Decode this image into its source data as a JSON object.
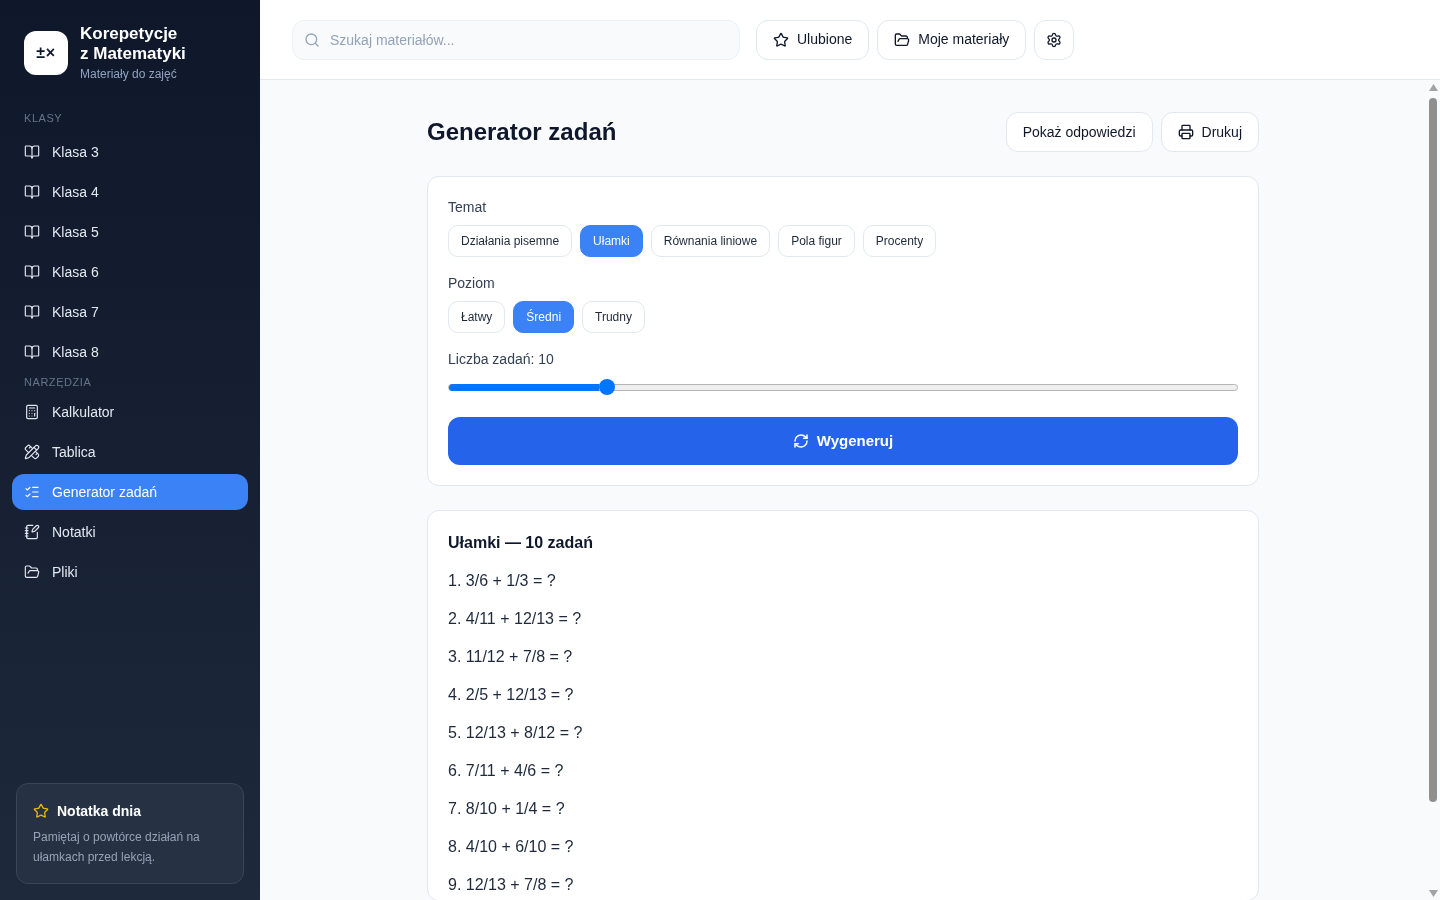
{
  "sidebar": {
    "logo": "±×",
    "title_lines": [
      "Korepetycje",
      "z Matematyki"
    ],
    "subtitle": "Materiały do zajęć",
    "sections": [
      {
        "label": "KLASY",
        "items": [
          {
            "label": "Klasa 3",
            "selected": false
          },
          {
            "label": "Klasa 4",
            "selected": false
          },
          {
            "label": "Klasa 5",
            "selected": false
          },
          {
            "label": "Klasa 6",
            "selected": false
          },
          {
            "label": "Klasa 7",
            "selected": false
          },
          {
            "label": "Klasa 8",
            "selected": false
          }
        ]
      },
      {
        "label": "NARZĘDZIA",
        "items": [
          {
            "label": "Kalkulator",
            "selected": false
          },
          {
            "label": "Tablica",
            "selected": false
          },
          {
            "label": "Generator zadań",
            "selected": true
          },
          {
            "label": "Notatki",
            "selected": false
          },
          {
            "label": "Pliki",
            "selected": false
          }
        ]
      }
    ],
    "note_card": {
      "title": "Notatka dnia",
      "text": "Pamiętaj o powtórce działań na ułamkach przed lekcją."
    }
  },
  "top_bar": {
    "search": {
      "placeholder": "Szukaj materiałów..."
    },
    "buttons": [
      "Ulubione",
      "Moje materiały"
    ]
  },
  "page": {
    "title": "Generator zadań",
    "actions": [
      "Pokaż odpowiedzi",
      "Drukuj"
    ]
  },
  "generator": {
    "topic": {
      "label": "Temat",
      "options": [
        {
          "label": "Działania pisemne",
          "selected": false
        },
        {
          "label": "Ułamki",
          "selected": true
        },
        {
          "label": "Równania liniowe",
          "selected": false
        },
        {
          "label": "Pola figur",
          "selected": false
        },
        {
          "label": "Procenty",
          "selected": false
        }
      ]
    },
    "difficulty": {
      "label": "Poziom",
      "options": [
        {
          "label": "Łatwy",
          "selected": false
        },
        {
          "label": "Średni",
          "selected": true
        },
        {
          "label": "Trudny",
          "selected": false
        }
      ]
    },
    "count": {
      "label": "Liczba zadań: 10",
      "level": 0.2
    },
    "generate_button": "Wygeneruj"
  },
  "results": {
    "title": "Ułamki — 10 zadań",
    "problems": [
      "1. 3/6 + 1/3 = ?",
      "2. 4/11 + 12/13 = ?",
      "3. 11/12 + 7/8 = ?",
      "4. 2/5 + 12/13 = ?",
      "5. 12/13 + 8/12 = ?",
      "6. 7/11 + 4/6 = ?",
      "7. 8/10 + 1/4 = ?",
      "8. 4/10 + 6/10 = ?",
      "9. 12/13 + 7/8 = ?"
    ]
  }
}
